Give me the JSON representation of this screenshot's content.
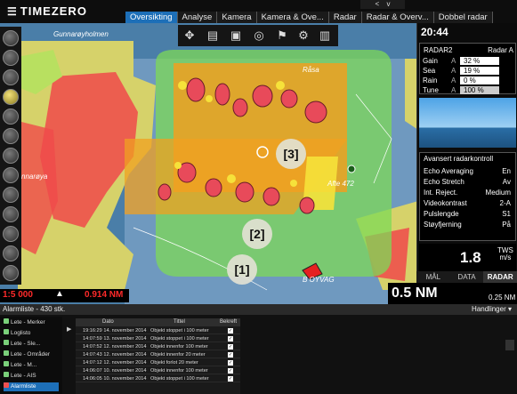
{
  "app": {
    "logo": "TIMEZERO"
  },
  "window_controls": {
    "left": "<",
    "right": "v"
  },
  "tabs": [
    "Oversikting",
    "Analyse",
    "Kamera",
    "Kamera & Ove...",
    "Radar",
    "Radar & Overv...",
    "Dobbel radar"
  ],
  "map": {
    "place_labels": {
      "north": "Gunnarøyholmen",
      "west": "nnarøya",
      "rasa": "Råsa",
      "boat": "Afte 472",
      "vessel": "B OYVAG"
    },
    "callouts": [
      "[3]",
      "[2]",
      "[1]"
    ],
    "scale_left": "1:5 000",
    "scale_right": "0.914 NM"
  },
  "radar": {
    "time": "20:44",
    "name": "RADAR2",
    "unit": "Radar A",
    "controls": [
      {
        "label": "Gain",
        "mode": "A",
        "value": "32 %"
      },
      {
        "label": "Sea",
        "mode": "A",
        "value": "19 %"
      },
      {
        "label": "Rain",
        "mode": "A",
        "value": "0 %"
      },
      {
        "label": "Tune",
        "mode": "A",
        "value": "100 %"
      }
    ],
    "advanced_title": "Avansert radarkontroll",
    "advanced": [
      {
        "label": "Echo Averaging",
        "value": "En"
      },
      {
        "label": "Echo Stretch",
        "value": "Av"
      },
      {
        "label": "Int. Reject.",
        "value": "Medium"
      },
      {
        "label": "Videokontrast",
        "value": "2-A"
      },
      {
        "label": "Pulslengde",
        "value": "S1"
      },
      {
        "label": "Støyfjerning",
        "value": "På"
      }
    ],
    "tws_value": "1.8",
    "tws_label": "TWS",
    "tws_unit": "m/s",
    "tabs": [
      "MÅL",
      "DATA",
      "RADAR"
    ],
    "range_main": "0.5 NM",
    "range_small": "0.25 NM"
  },
  "alarms": {
    "header": "Alarmliste - 430 stk.",
    "actions": "Handlinger",
    "sidebar": [
      "Lete - Merker",
      "Loglisto",
      "Lete - Sle...",
      "Lete - Områder",
      "Lete - M...",
      "Lete - AIS",
      "Alarmliste"
    ],
    "columns": [
      "Dato",
      "Tittel",
      "Bekreft"
    ],
    "rows": [
      {
        "date": "19:16:29 14. november 2014",
        "title": "Objekt stoppet i 100 meter"
      },
      {
        "date": "14:07:59 13. november 2014",
        "title": "Objekt stoppet i 100 meter"
      },
      {
        "date": "14:07:52 12. november 2014",
        "title": "Objekt innenfor 100 meter"
      },
      {
        "date": "14:07:43 12. november 2014",
        "title": "Objekt innenfor 20 meter"
      },
      {
        "date": "14:07:12 12. november 2014",
        "title": "Objekt forlot 20 meter"
      },
      {
        "date": "14:06:07 10. november 2014",
        "title": "Objekt innenfor 100 meter"
      },
      {
        "date": "14:06:05 10. november 2014",
        "title": "Objekt stoppet i 100 meter"
      }
    ],
    "checkmark": "✓"
  },
  "colors": {
    "accent": "#1d6fb8",
    "sea": "#4a7ea8",
    "land": "#d8d86a",
    "radar_green": "#7ed957",
    "radar_orange": "#f0a020"
  }
}
